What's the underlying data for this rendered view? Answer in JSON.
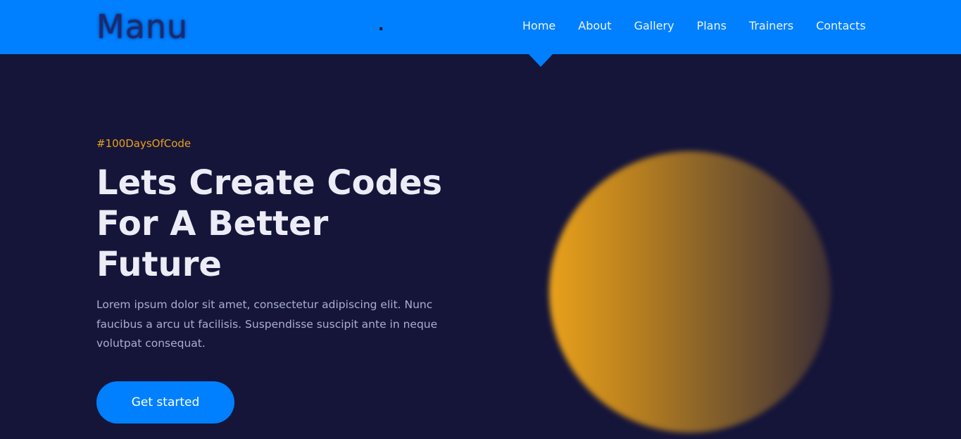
{
  "header": {
    "logo": "Manu",
    "dot": ".",
    "nav": [
      {
        "label": "Home"
      },
      {
        "label": "About"
      },
      {
        "label": "Gallery"
      },
      {
        "label": "Plans"
      },
      {
        "label": "Trainers"
      },
      {
        "label": "Contacts"
      }
    ],
    "active_item": "Home"
  },
  "hero": {
    "tag": "#100DaysOfCode",
    "headline_line1": "Lets Create Codes",
    "headline_line2": "For A Better",
    "headline_line3": "Future",
    "body": "Lorem ipsum dolor sit amet, consectetur adipiscing elit. Nunc faucibus a arcu ut facilisis. Suspendisse suscipit ante in neque volutpat consequat.",
    "cta_label": "Get started"
  },
  "colors": {
    "brand_blue": "#0080ff",
    "background": "#15153a",
    "accent_orange": "#e8a21a",
    "heading": "#ececf6",
    "body_text": "#a9aed0"
  }
}
